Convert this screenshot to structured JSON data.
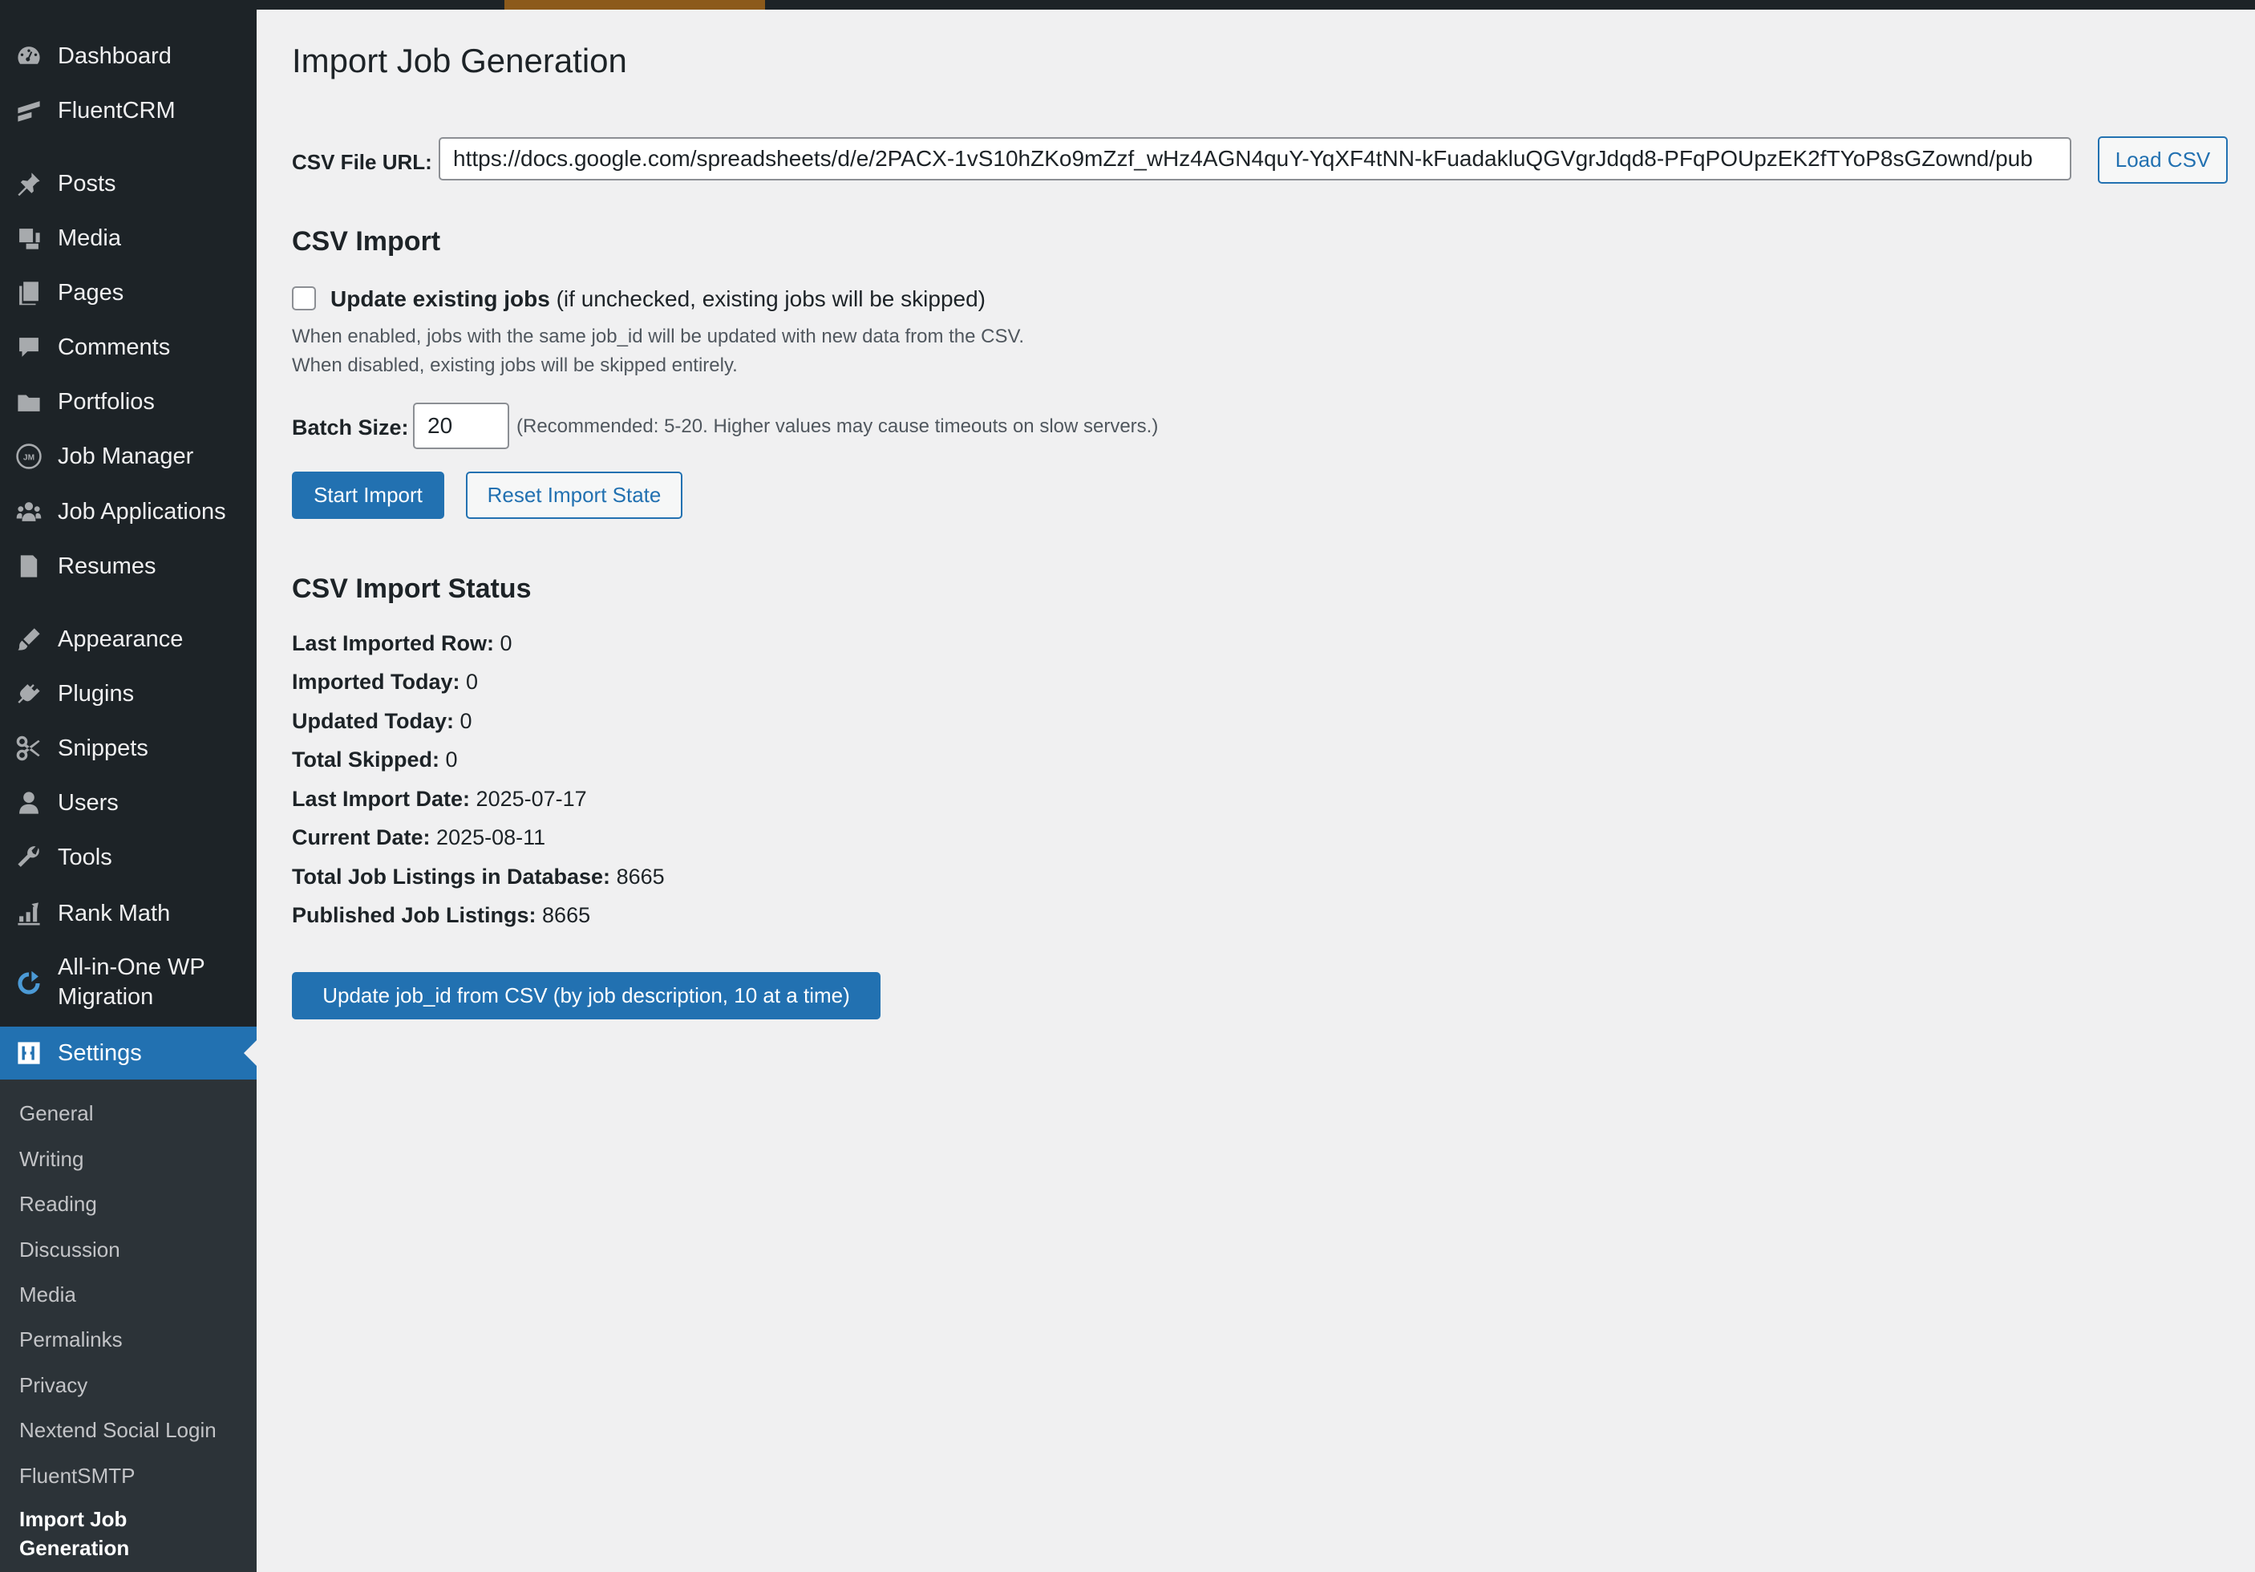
{
  "sidebar": {
    "items": [
      {
        "label": "Dashboard",
        "icon": "dashboard-icon"
      },
      {
        "label": "FluentCRM",
        "icon": "fluentcrm-icon"
      },
      {
        "label": "Posts",
        "icon": "pushpin-icon"
      },
      {
        "label": "Media",
        "icon": "media-icon"
      },
      {
        "label": "Pages",
        "icon": "pages-icon"
      },
      {
        "label": "Comments",
        "icon": "comment-bubble-icon"
      },
      {
        "label": "Portfolios",
        "icon": "folder-icon"
      },
      {
        "label": "Job Manager",
        "icon": "jm-badge-icon"
      },
      {
        "label": "Job Applications",
        "icon": "users-group-icon"
      },
      {
        "label": "Resumes",
        "icon": "document-icon"
      },
      {
        "label": "Appearance",
        "icon": "paintbrush-icon"
      },
      {
        "label": "Plugins",
        "icon": "plug-icon"
      },
      {
        "label": "Snippets",
        "icon": "scissors-icon"
      },
      {
        "label": "Users",
        "icon": "user-icon"
      },
      {
        "label": "Tools",
        "icon": "wrench-icon"
      },
      {
        "label": "Rank Math",
        "icon": "rank-math-icon"
      },
      {
        "label": "All-in-One WP Migration",
        "icon": "migration-icon"
      },
      {
        "label": "Settings",
        "icon": "settings-sliders-icon",
        "active": true
      }
    ],
    "settings_submenu": [
      "General",
      "Writing",
      "Reading",
      "Discussion",
      "Media",
      "Permalinks",
      "Privacy",
      "Nextend Social Login",
      "FluentSMTP",
      "Import Job Generation"
    ],
    "current_submenu": "Import Job Generation"
  },
  "page": {
    "title": "Import Job Generation",
    "csv_url_label": "CSV File URL:",
    "csv_url_value": "https://docs.google.com/spreadsheets/d/e/2PACX-1vS10hZKo9mZzf_wHz4AGN4quY-YqXF4tNN-kFuadakluQGVgrJdqd8-PFqPOUpzEK2fTYoP8sGZownd/pub",
    "load_csv_button": "Load CSV",
    "csv_import_heading": "CSV Import",
    "update_existing_label_bold": "Update existing jobs",
    "update_existing_label_rest": "(if unchecked, existing jobs will be skipped)",
    "update_existing_checked": false,
    "desc_line1": "When enabled, jobs with the same job_id will be updated with new data from the CSV.",
    "desc_line2": "When disabled, existing jobs will be skipped entirely.",
    "batch_size_label": "Batch Size:",
    "batch_size_value": "20",
    "batch_size_hint": "(Recommended: 5-20. Higher values may cause timeouts on slow servers.)",
    "start_import_button": "Start Import",
    "reset_import_button": "Reset Import State",
    "status_heading": "CSV Import Status",
    "status": [
      {
        "key": "Last Imported Row:",
        "value": "0"
      },
      {
        "key": "Imported Today:",
        "value": "0"
      },
      {
        "key": "Updated Today:",
        "value": "0"
      },
      {
        "key": "Total Skipped:",
        "value": "0"
      },
      {
        "key": "Last Import Date:",
        "value": "2025-07-17"
      },
      {
        "key": "Current Date:",
        "value": "2025-08-11"
      },
      {
        "key": "Total Job Listings in Database:",
        "value": "8665"
      },
      {
        "key": "Published Job Listings:",
        "value": "8665"
      }
    ],
    "update_job_id_button": "Update job_id from CSV (by job description, 10 at a time)"
  },
  "colors": {
    "sidebar_bg": "#1d2327",
    "submenu_bg": "#2c3338",
    "accent": "#2271b1",
    "page_bg": "#f0f0f1",
    "topbar_accent": "#8c5a1b"
  }
}
